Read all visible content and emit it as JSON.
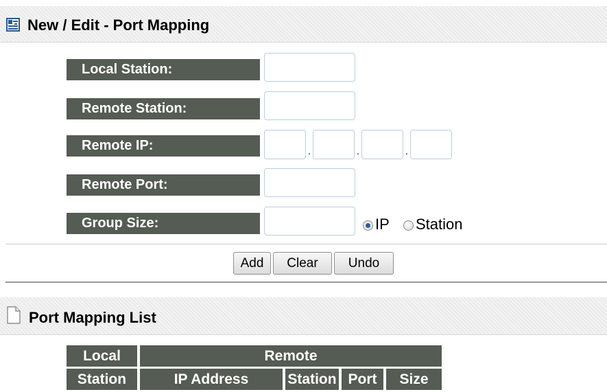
{
  "edit_section": {
    "title": "New / Edit - Port Mapping",
    "icon": "edit-icon"
  },
  "form": {
    "local_station_label": "Local Station:",
    "local_station_value": "",
    "remote_station_label": "Remote Station:",
    "remote_station_value": "",
    "remote_ip_label": "Remote IP:",
    "remote_ip_octets": [
      "",
      "",
      "",
      ""
    ],
    "remote_ip_separator": ".",
    "remote_port_label": "Remote Port:",
    "remote_port_value": "",
    "group_size_label": "Group Size:",
    "group_size_value": "",
    "group_type_options": [
      {
        "label": "IP",
        "selected": true
      },
      {
        "label": "Station",
        "selected": false
      }
    ]
  },
  "buttons": {
    "add": "Add",
    "clear": "Clear",
    "undo": "Undo"
  },
  "list_section": {
    "title": "Port Mapping List",
    "icon": "document-icon",
    "table": {
      "group_headers": [
        "Local",
        "Remote"
      ],
      "columns": [
        "Station",
        "IP Address",
        "Station",
        "Port",
        "Size"
      ]
    }
  },
  "colors": {
    "label_bg": "#555c53",
    "label_text": "#ffffff",
    "input_border": "#b8cfe0",
    "radio_selected": "#2b5e9c"
  }
}
